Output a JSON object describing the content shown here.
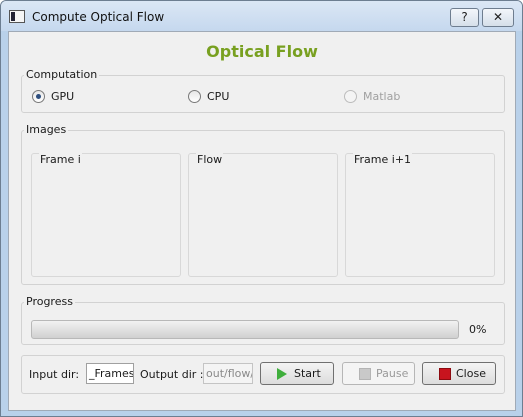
{
  "window": {
    "title": "Compute Optical Flow",
    "help_label": "?",
    "close_label": "✕"
  },
  "heading": "Optical Flow",
  "computation": {
    "title": "Computation",
    "options": [
      {
        "label": "GPU",
        "selected": true,
        "enabled": true
      },
      {
        "label": "CPU",
        "selected": false,
        "enabled": true
      },
      {
        "label": "Matlab",
        "selected": false,
        "enabled": false
      }
    ]
  },
  "images": {
    "title": "Images",
    "panels": [
      {
        "title": "Frame i"
      },
      {
        "title": "Flow"
      },
      {
        "title": "Frame i+1"
      }
    ]
  },
  "progress": {
    "title": "Progress",
    "value": 0,
    "text": "0%"
  },
  "io": {
    "input_label": "Input dir:",
    "input_value": "_Frames/",
    "output_label": "Output dir :",
    "output_value": "out/flow/",
    "start_label": "Start",
    "pause_label": "Pause",
    "close_label": "Close"
  },
  "colors": {
    "heading": "#78a020",
    "start_icon": "#3fae3c",
    "stop_icon": "#c8141e"
  }
}
